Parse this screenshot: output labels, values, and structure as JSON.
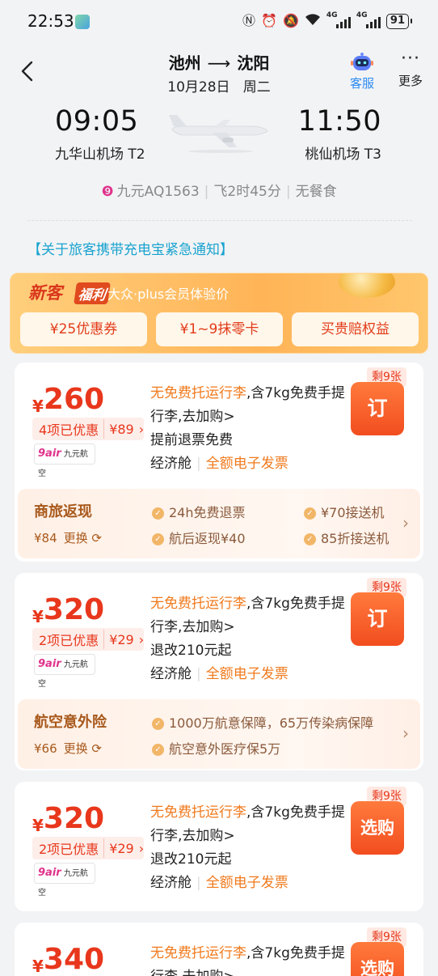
{
  "status": {
    "time": "22:53",
    "battery": "91",
    "net1": "4G",
    "net2": "4G"
  },
  "header": {
    "from": "池州",
    "to": "沈阳",
    "arrow": "⟶",
    "date": "10月28日",
    "weekday": "周二",
    "service_label": "客服",
    "more_label": "更多"
  },
  "flight": {
    "dep_time": "09:05",
    "dep_airport": "九华山机场 T2",
    "arr_time": "11:50",
    "arr_airport": "桃仙机场 T3",
    "flight_no": "九元AQ1563",
    "duration": "飞2时45分",
    "meal": "无餐食"
  },
  "notice": "【关于旅客携带充电宝紧急通知】",
  "promo": {
    "title_a": "新客",
    "title_b": "福利",
    "subtitle": "大众·plus会员体验价",
    "buttons": [
      "¥25优惠券",
      "¥1~9抹零卡",
      "买贵赔权益"
    ]
  },
  "common": {
    "yen": "¥",
    "baggage_orange": "无免费托运行李",
    "baggage_rest": ",含7kg免费手提行李,去加购>",
    "cabin": "经济舱",
    "invoice": "全额电子发票",
    "airline_logo": "9air",
    "airline_name": "九元航空",
    "switch": "更换"
  },
  "cards": [
    {
      "price": "260",
      "disc_text": "4项已优惠",
      "disc_amount": "¥89",
      "refund": "提前退票免费",
      "button": "订",
      "remain": "剩9张",
      "addon": {
        "title": "商旅返现",
        "price": "¥84",
        "items": [
          "24h免费退票",
          "¥70接送机",
          "航后返现¥40",
          "85折接送机"
        ]
      }
    },
    {
      "price": "320",
      "disc_text": "2项已优惠",
      "disc_amount": "¥29",
      "refund": "退改210元起",
      "button": "订",
      "remain": "剩9张",
      "addon": {
        "title": "航空意外险",
        "price": "¥66",
        "items": [
          "1000万航意保障，65万传染病保障",
          "航空意外医疗保5万"
        ]
      }
    },
    {
      "price": "320",
      "disc_text": "2项已优惠",
      "disc_amount": "¥29",
      "refund": "退改210元起",
      "button": "选购",
      "remain": "剩9张"
    },
    {
      "price": "340",
      "button": "选购",
      "remain": "剩9张"
    }
  ]
}
